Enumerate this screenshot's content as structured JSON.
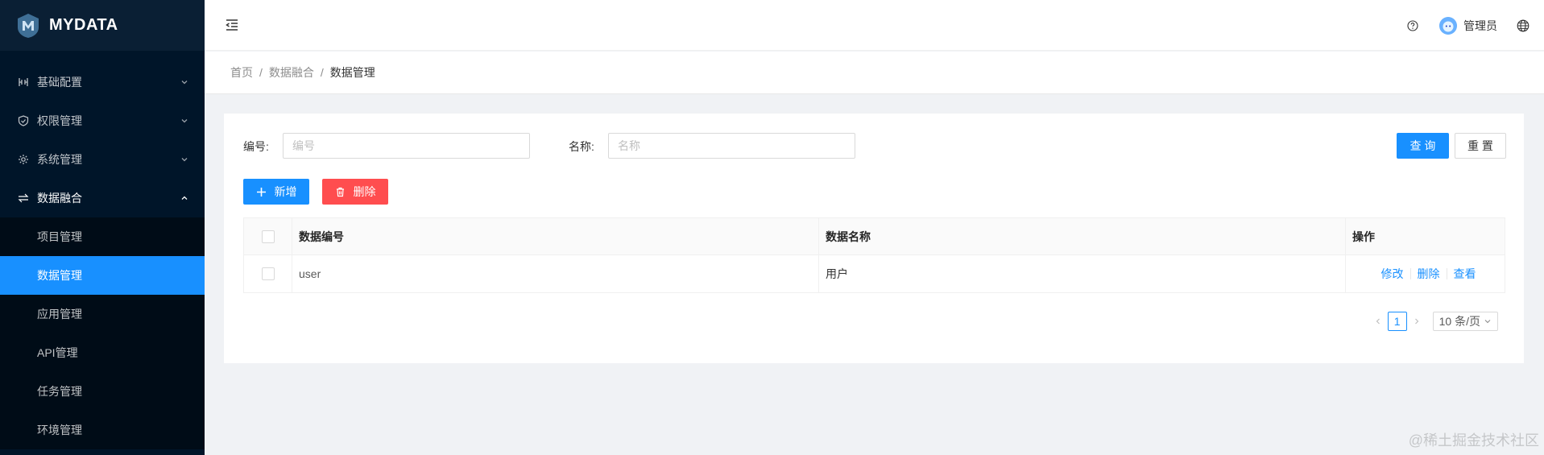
{
  "app": {
    "logo_text": "MYDATA"
  },
  "sidebar": {
    "menus": [
      {
        "label": "基础配置",
        "icon": "sliders-icon",
        "open": false
      },
      {
        "label": "权限管理",
        "icon": "shield-icon",
        "open": false
      },
      {
        "label": "系统管理",
        "icon": "gear-icon",
        "open": false
      },
      {
        "label": "数据融合",
        "icon": "swap-icon",
        "open": true
      }
    ],
    "submenu": [
      {
        "label": "项目管理",
        "active": false
      },
      {
        "label": "数据管理",
        "active": true
      },
      {
        "label": "应用管理",
        "active": false
      },
      {
        "label": "API管理",
        "active": false
      },
      {
        "label": "任务管理",
        "active": false
      },
      {
        "label": "环境管理",
        "active": false
      }
    ]
  },
  "header": {
    "username": "管理员"
  },
  "breadcrumb": {
    "items": [
      "首页",
      "数据融合",
      "数据管理"
    ],
    "separator": "/"
  },
  "search": {
    "code_label": "编号:",
    "code_placeholder": "编号",
    "code_value": "",
    "name_label": "名称:",
    "name_placeholder": "名称",
    "name_value": "",
    "query_label": "查 询",
    "reset_label": "重 置"
  },
  "toolbar": {
    "add_label": "新增",
    "delete_label": "删除"
  },
  "table": {
    "columns": [
      "数据编号",
      "数据名称",
      "操作"
    ],
    "rows": [
      {
        "code": "user",
        "name": "用户",
        "actions": [
          "修改",
          "删除",
          "查看"
        ]
      }
    ]
  },
  "pagination": {
    "current": "1",
    "page_size": "10 条/页"
  },
  "watermark": "@稀土掘金技术社区",
  "colors": {
    "primary": "#1890ff",
    "danger": "#ff4d4f",
    "sidebar_bg": "#001529",
    "submenu_bg": "#000c17"
  }
}
